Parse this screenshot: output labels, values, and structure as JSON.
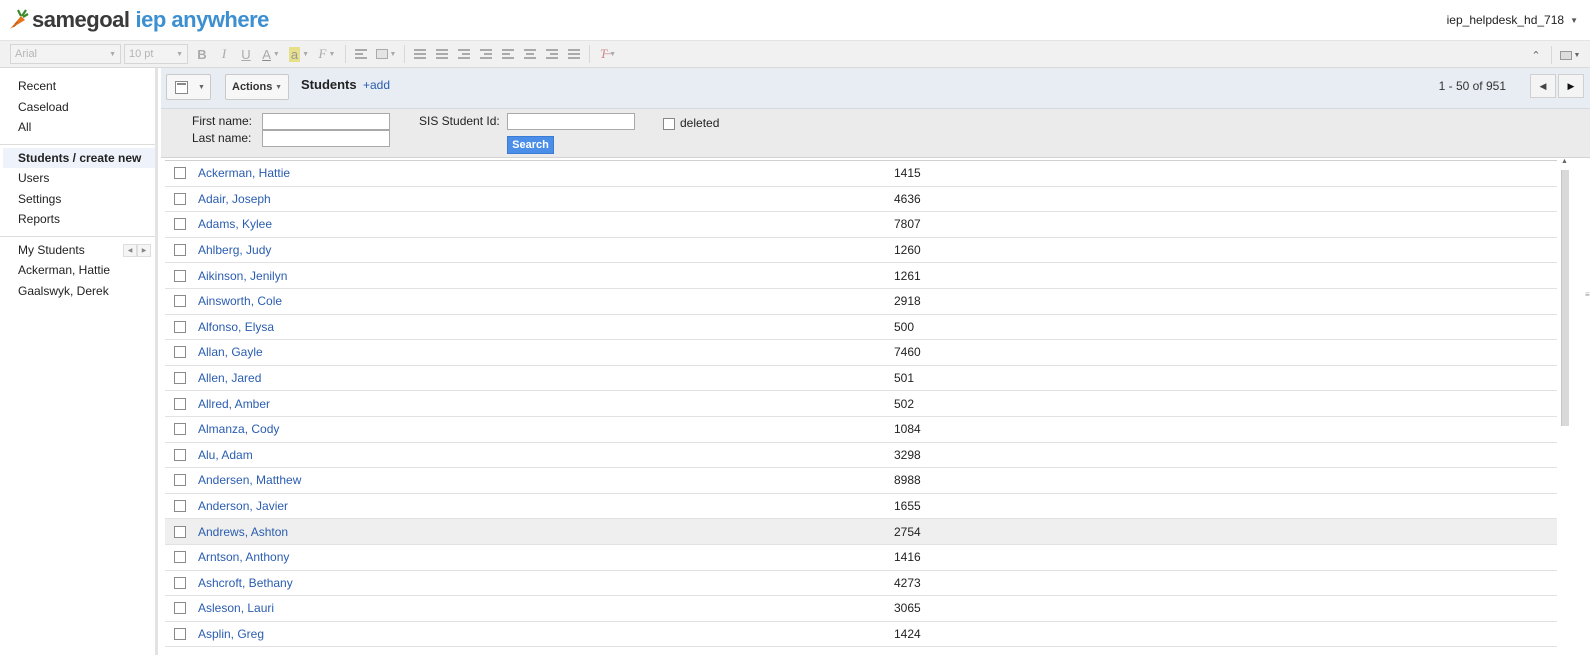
{
  "app": {
    "logo_word1": "samegoal",
    "logo_word2": "iep anywhere",
    "user": "iep_helpdesk_hd_718"
  },
  "toolbar": {
    "font_family": "Arial",
    "font_size": "10 pt",
    "bold": "B",
    "italic": "I",
    "underline": "U",
    "text_color": "A",
    "highlight": "a",
    "font_effect": "F"
  },
  "sidebar": {
    "top_items": [
      "Recent",
      "Caseload",
      "All"
    ],
    "main_items": [
      "Students / create new",
      "Users",
      "Settings",
      "Reports"
    ],
    "active_item": "Students / create new",
    "my_students_label": "My Students",
    "my_students": [
      "Ackerman, Hattie",
      "Gaalswyk, Derek"
    ]
  },
  "action_bar": {
    "actions_label": "Actions",
    "title": "Students",
    "add_label": "+add",
    "pager_text": "1 - 50 of 951"
  },
  "search": {
    "first_name_label": "First name:",
    "last_name_label": "Last name:",
    "sis_label": "SIS Student Id:",
    "deleted_label": "deleted",
    "search_button": "Search",
    "first_name_value": "",
    "last_name_value": "",
    "sis_value": ""
  },
  "students": [
    {
      "name": "Ackerman, Hattie",
      "id": "1415"
    },
    {
      "name": "Adair, Joseph",
      "id": "4636"
    },
    {
      "name": "Adams, Kylee",
      "id": "7807"
    },
    {
      "name": "Ahlberg, Judy",
      "id": "1260"
    },
    {
      "name": "Aikinson, Jenilyn",
      "id": "1261"
    },
    {
      "name": "Ainsworth, Cole",
      "id": "2918"
    },
    {
      "name": "Alfonso, Elysa",
      "id": "500"
    },
    {
      "name": "Allan, Gayle",
      "id": "7460"
    },
    {
      "name": "Allen, Jared",
      "id": "501"
    },
    {
      "name": "Allred, Amber",
      "id": "502"
    },
    {
      "name": "Almanza, Cody",
      "id": "1084"
    },
    {
      "name": "Alu, Adam",
      "id": "3298"
    },
    {
      "name": "Andersen, Matthew",
      "id": "8988"
    },
    {
      "name": "Anderson, Javier",
      "id": "1655"
    },
    {
      "name": "Andrews, Ashton",
      "id": "2754"
    },
    {
      "name": "Arntson, Anthony",
      "id": "1416"
    },
    {
      "name": "Ashcroft, Bethany",
      "id": "4273"
    },
    {
      "name": "Asleson, Lauri",
      "id": "3065"
    },
    {
      "name": "Asplin, Greg",
      "id": "1424"
    }
  ],
  "highlighted_row_index": 14,
  "colors": {
    "link": "#2a5db0",
    "brand_blue": "#3c8fd0",
    "search_button": "#4a8ee8",
    "action_bar_bg": "#e8ecf3"
  }
}
